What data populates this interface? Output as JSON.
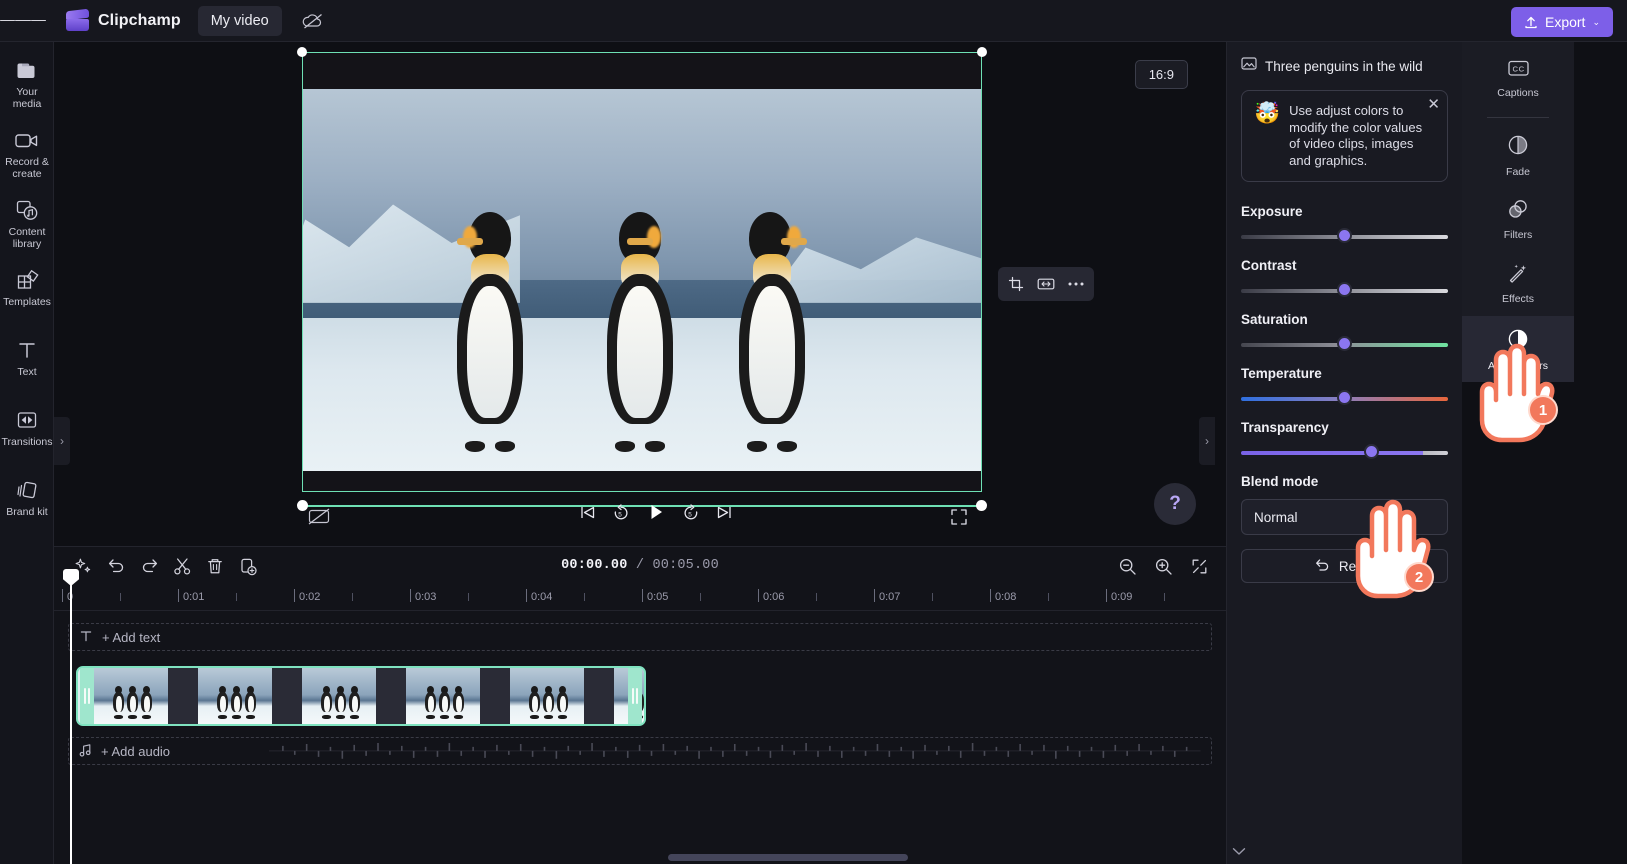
{
  "topbar": {
    "menu_icon": "hamburger-menu-icon",
    "brand": "Clipchamp",
    "project_name": "My video",
    "cloud_icon": "cloud-off-icon",
    "export_label": "Export",
    "export_caret": "⌄"
  },
  "left_rail": {
    "items": [
      {
        "label": "Your media",
        "icon": "media-folder-icon"
      },
      {
        "label": "Record & create",
        "icon": "camera-icon"
      },
      {
        "label": "Content library",
        "icon": "content-library-icon"
      },
      {
        "label": "Templates",
        "icon": "templates-icon"
      },
      {
        "label": "Text",
        "icon": "text-icon"
      },
      {
        "label": "Transitions",
        "icon": "transitions-icon"
      },
      {
        "label": "Brand kit",
        "icon": "brand-kit-icon"
      }
    ]
  },
  "preview": {
    "aspect_ratio": "16:9",
    "floating_tools": [
      "crop-icon",
      "fit-fill-icon",
      "more-options-icon"
    ],
    "help_label": "?",
    "controls": {
      "captions": "closed-captions-off-icon",
      "skip_back": "skip-to-start-icon",
      "rewind": "rewind-5-seconds-icon",
      "play": "play-icon",
      "forward": "forward-5-seconds-icon",
      "skip_forward": "skip-to-end-icon",
      "fullscreen": "fullscreen-icon"
    }
  },
  "properties": {
    "clip_title": "Three penguins in the wild",
    "clip_icon": "image-clip-icon",
    "tip": {
      "emoji": "🤯",
      "text": "Use adjust colors to modify the color values of video clips, images and graphics.",
      "close_icon": "close-icon"
    },
    "sliders": [
      {
        "name": "Exposure",
        "value": 50
      },
      {
        "name": "Contrast",
        "value": 50
      },
      {
        "name": "Saturation",
        "value": 50
      },
      {
        "name": "Temperature",
        "value": 50
      },
      {
        "name": "Transparency",
        "value": 63
      }
    ],
    "blend_mode_label": "Blend mode",
    "blend_mode_value": "Normal",
    "reset_label": "Reset",
    "reset_icon": "undo-icon"
  },
  "tool_rail": {
    "items": [
      {
        "label": "Captions",
        "icon": "captions-cc-icon",
        "active": false
      },
      {
        "label": "Fade",
        "icon": "fade-icon",
        "active": false
      },
      {
        "label": "Filters",
        "icon": "filters-icon",
        "active": false
      },
      {
        "label": "Effects",
        "icon": "effects-wand-icon",
        "active": false
      },
      {
        "label": "Adjust colors",
        "icon": "adjust-colors-icon",
        "active": true
      }
    ]
  },
  "timeline": {
    "tools": [
      {
        "icon": "magic-sparkle-icon",
        "name": "auto-compose-button"
      },
      {
        "icon": "undo-icon",
        "name": "undo-button"
      },
      {
        "icon": "redo-icon",
        "name": "redo-button"
      },
      {
        "icon": "scissors-icon",
        "name": "split-button"
      },
      {
        "icon": "trash-icon",
        "name": "delete-button"
      },
      {
        "icon": "duplicate-icon",
        "name": "duplicate-button"
      }
    ],
    "current_time": "00:00.00",
    "separator": "/",
    "total_time": "00:05.00",
    "zoom_controls": [
      {
        "icon": "zoom-out-icon",
        "name": "zoom-out-button"
      },
      {
        "icon": "zoom-in-icon",
        "name": "zoom-in-button"
      },
      {
        "icon": "fit-timeline-icon",
        "name": "fit-to-timeline-button"
      }
    ],
    "ruler_labels": [
      "0",
      "0:01",
      "0:02",
      "0:03",
      "0:04",
      "0:05",
      "0:06",
      "0:07",
      "0:08",
      "0:09"
    ],
    "add_text_label": "+ Add text",
    "add_text_icon": "text-t-icon",
    "add_audio_label": "+ Add audio",
    "add_audio_icon": "music-note-icon",
    "collapse_icon": "chevron-down-icon"
  },
  "annotations": [
    {
      "step": "1",
      "target": "adjust-colors-tool"
    },
    {
      "step": "2",
      "target": "transparency-slider"
    }
  ],
  "colors": {
    "accent": "#7d5fe8",
    "selection": "#6ee0b4",
    "slider_thumb": "#8b76f0",
    "annotation": "#f2785c"
  }
}
